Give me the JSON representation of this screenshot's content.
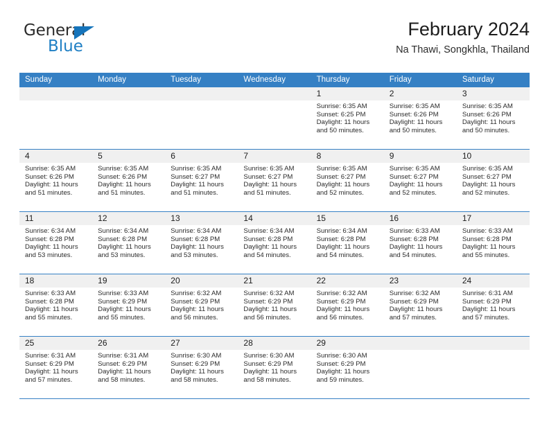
{
  "logo": {
    "word_one": "General",
    "word_two": "Blue",
    "triangle_color": "#1574bb",
    "blue_color": "#1f7fc4"
  },
  "header": {
    "title": "February 2024",
    "subtitle": "Na Thawi, Songkhla, Thailand"
  },
  "theme": {
    "header_bg": "#3580c4",
    "header_text": "#ffffff",
    "daynum_band": "#f0f0f0",
    "grid_line": "#3580c4"
  },
  "weekdays": [
    "Sunday",
    "Monday",
    "Tuesday",
    "Wednesday",
    "Thursday",
    "Friday",
    "Saturday"
  ],
  "weeks": [
    [
      {
        "day": "",
        "empty": true
      },
      {
        "day": "",
        "empty": true
      },
      {
        "day": "",
        "empty": true
      },
      {
        "day": "",
        "empty": true
      },
      {
        "day": "1",
        "sunrise": "Sunrise: 6:35 AM",
        "sunset": "Sunset: 6:25 PM",
        "daylight1": "Daylight: 11 hours",
        "daylight2": "and 50 minutes."
      },
      {
        "day": "2",
        "sunrise": "Sunrise: 6:35 AM",
        "sunset": "Sunset: 6:26 PM",
        "daylight1": "Daylight: 11 hours",
        "daylight2": "and 50 minutes."
      },
      {
        "day": "3",
        "sunrise": "Sunrise: 6:35 AM",
        "sunset": "Sunset: 6:26 PM",
        "daylight1": "Daylight: 11 hours",
        "daylight2": "and 50 minutes."
      }
    ],
    [
      {
        "day": "4",
        "sunrise": "Sunrise: 6:35 AM",
        "sunset": "Sunset: 6:26 PM",
        "daylight1": "Daylight: 11 hours",
        "daylight2": "and 51 minutes."
      },
      {
        "day": "5",
        "sunrise": "Sunrise: 6:35 AM",
        "sunset": "Sunset: 6:26 PM",
        "daylight1": "Daylight: 11 hours",
        "daylight2": "and 51 minutes."
      },
      {
        "day": "6",
        "sunrise": "Sunrise: 6:35 AM",
        "sunset": "Sunset: 6:27 PM",
        "daylight1": "Daylight: 11 hours",
        "daylight2": "and 51 minutes."
      },
      {
        "day": "7",
        "sunrise": "Sunrise: 6:35 AM",
        "sunset": "Sunset: 6:27 PM",
        "daylight1": "Daylight: 11 hours",
        "daylight2": "and 51 minutes."
      },
      {
        "day": "8",
        "sunrise": "Sunrise: 6:35 AM",
        "sunset": "Sunset: 6:27 PM",
        "daylight1": "Daylight: 11 hours",
        "daylight2": "and 52 minutes."
      },
      {
        "day": "9",
        "sunrise": "Sunrise: 6:35 AM",
        "sunset": "Sunset: 6:27 PM",
        "daylight1": "Daylight: 11 hours",
        "daylight2": "and 52 minutes."
      },
      {
        "day": "10",
        "sunrise": "Sunrise: 6:35 AM",
        "sunset": "Sunset: 6:27 PM",
        "daylight1": "Daylight: 11 hours",
        "daylight2": "and 52 minutes."
      }
    ],
    [
      {
        "day": "11",
        "sunrise": "Sunrise: 6:34 AM",
        "sunset": "Sunset: 6:28 PM",
        "daylight1": "Daylight: 11 hours",
        "daylight2": "and 53 minutes."
      },
      {
        "day": "12",
        "sunrise": "Sunrise: 6:34 AM",
        "sunset": "Sunset: 6:28 PM",
        "daylight1": "Daylight: 11 hours",
        "daylight2": "and 53 minutes."
      },
      {
        "day": "13",
        "sunrise": "Sunrise: 6:34 AM",
        "sunset": "Sunset: 6:28 PM",
        "daylight1": "Daylight: 11 hours",
        "daylight2": "and 53 minutes."
      },
      {
        "day": "14",
        "sunrise": "Sunrise: 6:34 AM",
        "sunset": "Sunset: 6:28 PM",
        "daylight1": "Daylight: 11 hours",
        "daylight2": "and 54 minutes."
      },
      {
        "day": "15",
        "sunrise": "Sunrise: 6:34 AM",
        "sunset": "Sunset: 6:28 PM",
        "daylight1": "Daylight: 11 hours",
        "daylight2": "and 54 minutes."
      },
      {
        "day": "16",
        "sunrise": "Sunrise: 6:33 AM",
        "sunset": "Sunset: 6:28 PM",
        "daylight1": "Daylight: 11 hours",
        "daylight2": "and 54 minutes."
      },
      {
        "day": "17",
        "sunrise": "Sunrise: 6:33 AM",
        "sunset": "Sunset: 6:28 PM",
        "daylight1": "Daylight: 11 hours",
        "daylight2": "and 55 minutes."
      }
    ],
    [
      {
        "day": "18",
        "sunrise": "Sunrise: 6:33 AM",
        "sunset": "Sunset: 6:28 PM",
        "daylight1": "Daylight: 11 hours",
        "daylight2": "and 55 minutes."
      },
      {
        "day": "19",
        "sunrise": "Sunrise: 6:33 AM",
        "sunset": "Sunset: 6:29 PM",
        "daylight1": "Daylight: 11 hours",
        "daylight2": "and 55 minutes."
      },
      {
        "day": "20",
        "sunrise": "Sunrise: 6:32 AM",
        "sunset": "Sunset: 6:29 PM",
        "daylight1": "Daylight: 11 hours",
        "daylight2": "and 56 minutes."
      },
      {
        "day": "21",
        "sunrise": "Sunrise: 6:32 AM",
        "sunset": "Sunset: 6:29 PM",
        "daylight1": "Daylight: 11 hours",
        "daylight2": "and 56 minutes."
      },
      {
        "day": "22",
        "sunrise": "Sunrise: 6:32 AM",
        "sunset": "Sunset: 6:29 PM",
        "daylight1": "Daylight: 11 hours",
        "daylight2": "and 56 minutes."
      },
      {
        "day": "23",
        "sunrise": "Sunrise: 6:32 AM",
        "sunset": "Sunset: 6:29 PM",
        "daylight1": "Daylight: 11 hours",
        "daylight2": "and 57 minutes."
      },
      {
        "day": "24",
        "sunrise": "Sunrise: 6:31 AM",
        "sunset": "Sunset: 6:29 PM",
        "daylight1": "Daylight: 11 hours",
        "daylight2": "and 57 minutes."
      }
    ],
    [
      {
        "day": "25",
        "sunrise": "Sunrise: 6:31 AM",
        "sunset": "Sunset: 6:29 PM",
        "daylight1": "Daylight: 11 hours",
        "daylight2": "and 57 minutes."
      },
      {
        "day": "26",
        "sunrise": "Sunrise: 6:31 AM",
        "sunset": "Sunset: 6:29 PM",
        "daylight1": "Daylight: 11 hours",
        "daylight2": "and 58 minutes."
      },
      {
        "day": "27",
        "sunrise": "Sunrise: 6:30 AM",
        "sunset": "Sunset: 6:29 PM",
        "daylight1": "Daylight: 11 hours",
        "daylight2": "and 58 minutes."
      },
      {
        "day": "28",
        "sunrise": "Sunrise: 6:30 AM",
        "sunset": "Sunset: 6:29 PM",
        "daylight1": "Daylight: 11 hours",
        "daylight2": "and 58 minutes."
      },
      {
        "day": "29",
        "sunrise": "Sunrise: 6:30 AM",
        "sunset": "Sunset: 6:29 PM",
        "daylight1": "Daylight: 11 hours",
        "daylight2": "and 59 minutes."
      },
      {
        "day": "",
        "empty": true
      },
      {
        "day": "",
        "empty": true
      }
    ]
  ]
}
